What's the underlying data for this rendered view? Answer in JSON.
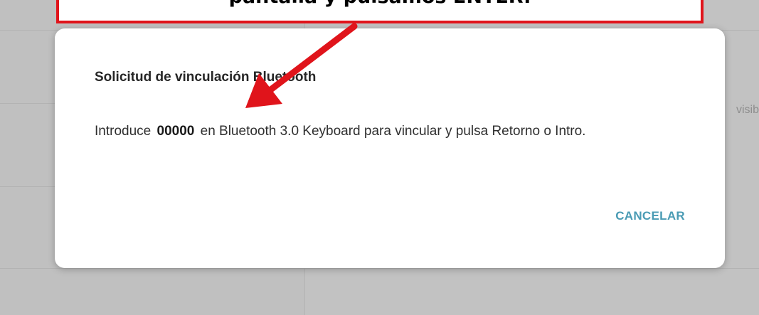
{
  "background": {
    "right_text": "visib"
  },
  "dialog": {
    "title": "Solicitud de vinculación Bluetooth",
    "message_before": "Introduce ",
    "code": "00000",
    "message_after": " en Bluetooth 3.0 Keyboard para vincular y pulsa Retorno o Intro.",
    "cancel_label": "CANCELAR"
  },
  "annotation": {
    "text": "pantalla y pulsamos ENTER.",
    "color": "#e0141b"
  }
}
